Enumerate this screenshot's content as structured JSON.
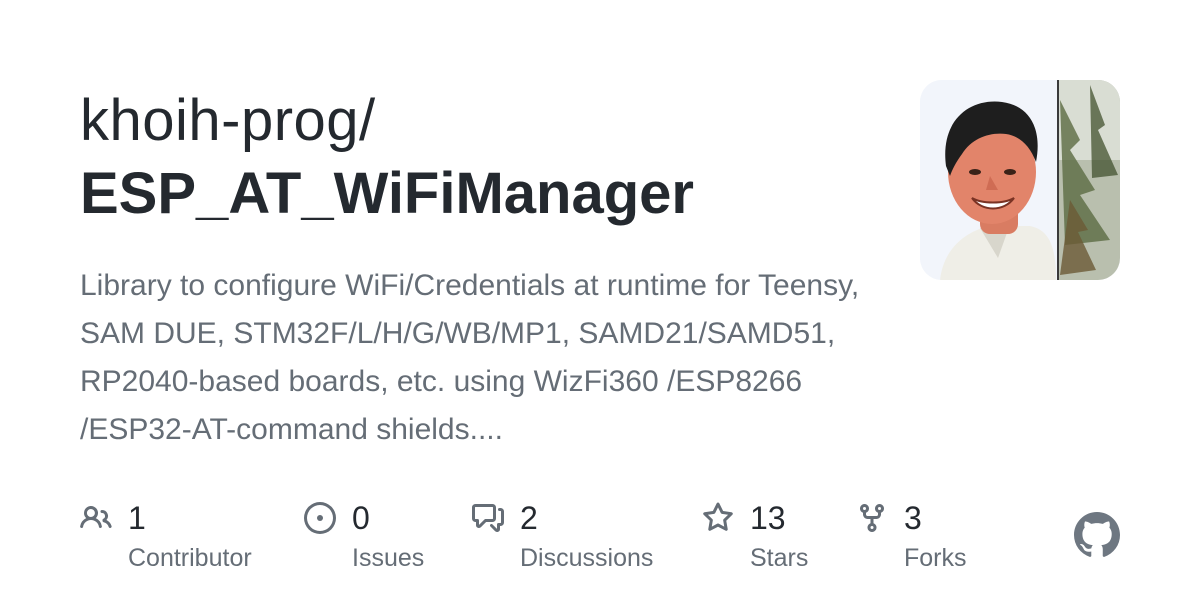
{
  "repo_card": {
    "owner": "khoih-prog/",
    "name": "ESP_AT_WiFiManager",
    "description": "Library to configure WiFi/Credentials at runtime for Teensy, SAM DUE, STM32F/L/H/G/WB/MP1, SAMD21/SAMD51, RP2040-based boards, etc. using WizFi360 /ESP8266 /ESP32-AT-command shields....",
    "stats": [
      {
        "count": "1",
        "label": "Contributor",
        "icon": "people-icon"
      },
      {
        "count": "0",
        "label": "Issues",
        "icon": "issue-opened-icon"
      },
      {
        "count": "2",
        "label": "Discussions",
        "icon": "comment-discussion-icon"
      },
      {
        "count": "13",
        "label": "Stars",
        "icon": "star-icon"
      },
      {
        "count": "3",
        "label": "Forks",
        "icon": "repo-forked-icon"
      }
    ],
    "brand_icon": "github-mark-icon"
  },
  "colors": {
    "text_primary": "#24292f",
    "text_secondary": "#656d76",
    "icon": "#656d76",
    "github_logo": "#6e7781",
    "background": "#ffffff"
  }
}
